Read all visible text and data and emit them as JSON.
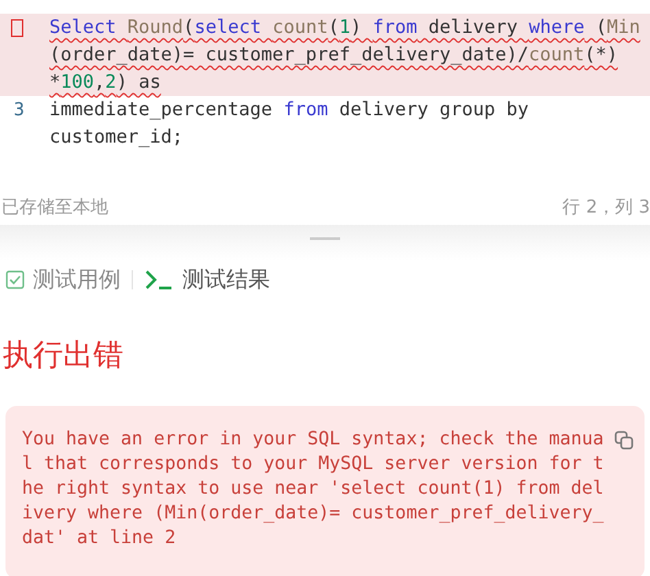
{
  "editor": {
    "lines": [
      {
        "error": true,
        "rows": [
          {
            "tokens": [
              {
                "kind": "keyword",
                "text": "Select "
              },
              {
                "kind": "function",
                "text": "Round"
              },
              {
                "kind": "plain",
                "text": "("
              },
              {
                "kind": "keyword",
                "text": "select "
              },
              {
                "kind": "function",
                "text": "count"
              },
              {
                "kind": "plain",
                "text": "("
              },
              {
                "kind": "number",
                "text": "1"
              },
              {
                "kind": "plain",
                "text": ") "
              },
              {
                "kind": "keyword",
                "text": "from"
              },
              {
                "kind": "plain",
                "text": " delivery "
              },
              {
                "kind": "keyword",
                "text": "where"
              },
              {
                "kind": "plain",
                "text": " ("
              },
              {
                "kind": "function",
                "text": "Min"
              }
            ]
          },
          {
            "tokens": [
              {
                "kind": "plain",
                "text": "(order_date)= customer_pref_delivery_date)/"
              },
              {
                "kind": "function",
                "text": "count"
              },
              {
                "kind": "plain",
                "text": "(*)"
              }
            ]
          },
          {
            "tokens": [
              {
                "kind": "plain",
                "text": "*"
              },
              {
                "kind": "number",
                "text": "100"
              },
              {
                "kind": "plain",
                "text": ","
              },
              {
                "kind": "number",
                "text": "2"
              },
              {
                "kind": "plain",
                "text": ") as"
              }
            ]
          }
        ]
      },
      {
        "number": "3",
        "error": false,
        "rows": [
          {
            "tokens": [
              {
                "kind": "plain",
                "text": "immediate_percentage "
              },
              {
                "kind": "keyword",
                "text": "from"
              },
              {
                "kind": "plain",
                "text": " delivery group by"
              }
            ]
          },
          {
            "tokens": [
              {
                "kind": "plain",
                "text": "customer_id;"
              }
            ]
          }
        ]
      }
    ]
  },
  "status_bar": {
    "left": "已存储至本地",
    "right": "行 2，列 3"
  },
  "tabs": [
    {
      "kind": "checkbox",
      "label": "测试用例",
      "selected": false
    },
    {
      "kind": "terminal",
      "label": "测试结果",
      "selected": true
    }
  ],
  "result": {
    "title": "执行出错",
    "message": "You have an error in your SQL syntax; check the manual that corresponds to your MySQL server version for the right syntax to use near 'select count(1) from delivery where (Min(order_date)= customer_pref_delivery_dat' at line 2"
  }
}
